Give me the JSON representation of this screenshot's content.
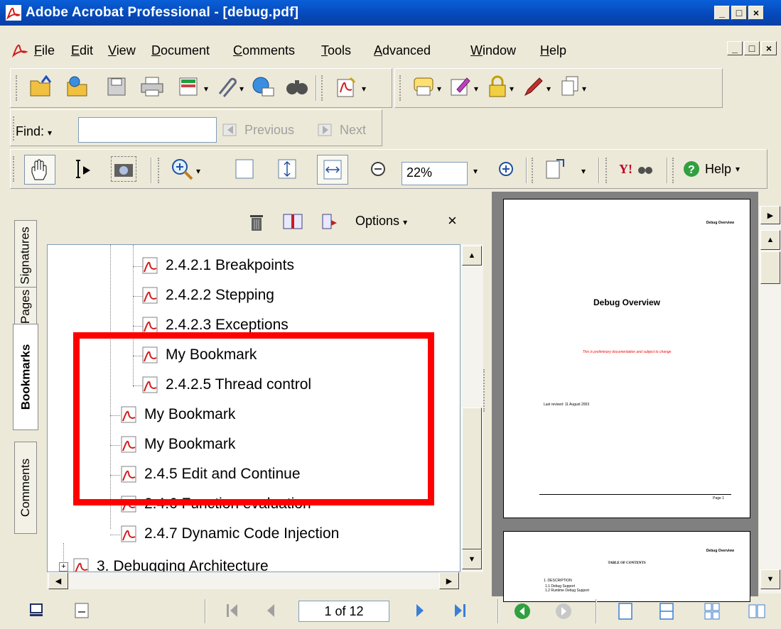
{
  "window": {
    "title": "Adobe Acrobat Professional - [debug.pdf]",
    "controls": [
      "_",
      "□",
      "×"
    ]
  },
  "menubar": {
    "items": [
      {
        "label": "File",
        "mnemonic": "F"
      },
      {
        "label": "Edit",
        "mnemonic": "E"
      },
      {
        "label": "View",
        "mnemonic": "V"
      },
      {
        "label": "Document",
        "mnemonic": "D"
      },
      {
        "label": "Comments",
        "mnemonic": "C"
      },
      {
        "label": "Tools",
        "mnemonic": "T"
      },
      {
        "label": "Advanced",
        "mnemonic": "A"
      },
      {
        "label": "Window",
        "mnemonic": "W"
      },
      {
        "label": "Help",
        "mnemonic": "H"
      }
    ]
  },
  "find_toolbar": {
    "label": "Find:",
    "value": "",
    "previous": "Previous",
    "next": "Next"
  },
  "zoom": {
    "value": "22%"
  },
  "help_label": "Help",
  "nav_tabs": [
    {
      "label": "Signatures"
    },
    {
      "label": "Pages"
    },
    {
      "label": "Bookmarks"
    },
    {
      "label": "Comments"
    }
  ],
  "panel": {
    "options_label": "Options",
    "close_label": "×"
  },
  "bookmarks": [
    {
      "label": "2.4.2.1 Breakpoints"
    },
    {
      "label": "2.4.2.2 Stepping"
    },
    {
      "label": "2.4.2.3 Exceptions"
    },
    {
      "label": "My Bookmark"
    },
    {
      "label": "2.4.2.5 Thread control"
    },
    {
      "label": "My Bookmark"
    },
    {
      "label": "My Bookmark"
    },
    {
      "label": "2.4.5 Edit and Continue"
    },
    {
      "label": "2.4.6 Function evaluation"
    },
    {
      "label": "2.4.7 Dynamic Code Injection"
    },
    {
      "label": "3. Debugging Architecture"
    }
  ],
  "document": {
    "page1": {
      "header": "Debug Overview",
      "title": "Debug Overview",
      "notice": "This is preliminary documentation and subject to change",
      "date": "Last revised: 11 August 2003",
      "footer": "Page 1"
    },
    "page2": {
      "header": "Debug Overview",
      "toc_title": "TABLE OF CONTENTS",
      "toc_line1": "1.   DESCRIPTION",
      "toc_line2": "1.1   Debug Support",
      "toc_line3": "1.2   Runtime Debug Support"
    }
  },
  "statusbar": {
    "page_indicator": "1 of 12"
  },
  "colors": {
    "highlight": "#ff0000",
    "titlebar": "#0548b8",
    "pdf_red": "#cc2222"
  }
}
